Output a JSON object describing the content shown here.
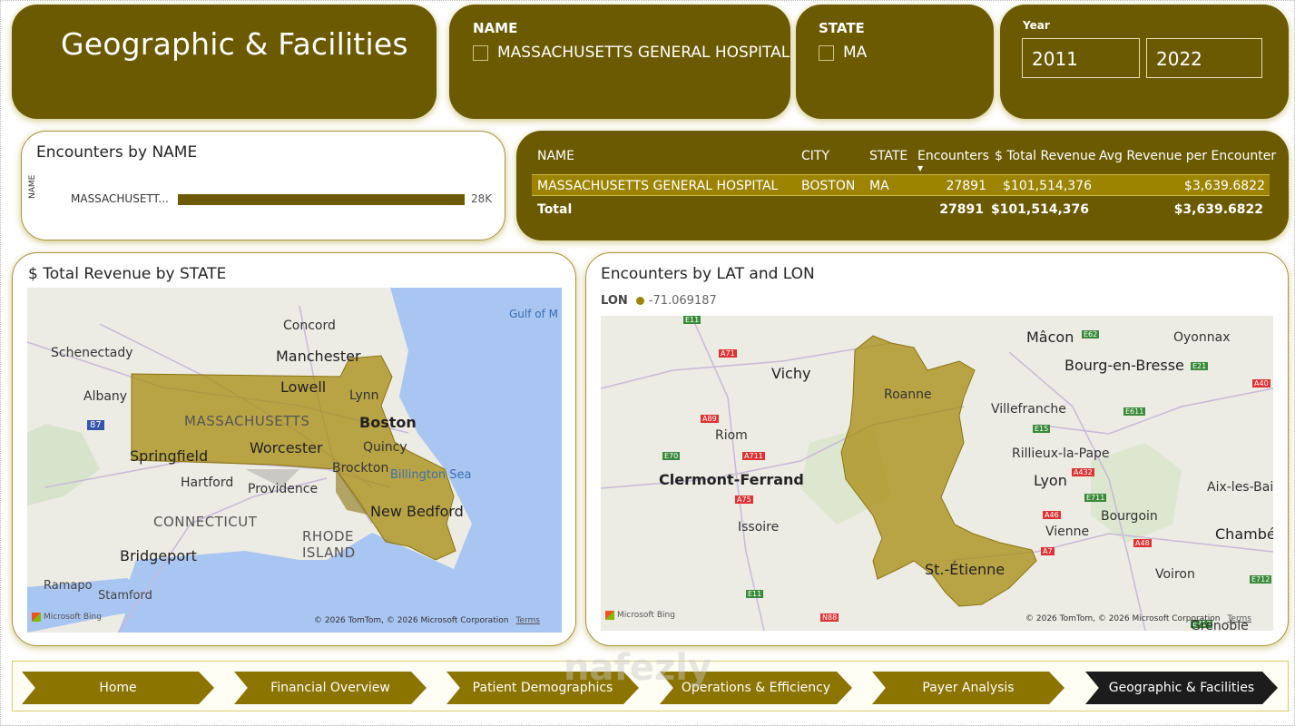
{
  "header": {
    "title": "Geographic & Facilities"
  },
  "slicers": {
    "name": {
      "label": "NAME",
      "item": "MASSACHUSETTS GENERAL HOSPITAL"
    },
    "state": {
      "label": "STATE",
      "item": "MA"
    },
    "year": {
      "label": "Year",
      "start": "2011",
      "end": "2022"
    }
  },
  "encounters_by_name": {
    "title": "Encounters by NAME",
    "axis_label": "NAME",
    "category": "MASSACHUSETT...",
    "value_label": "28K",
    "chart_data": {
      "type": "bar",
      "categories": [
        "MASSACHUSETT..."
      ],
      "values": [
        27891
      ],
      "ylabel": "NAME"
    }
  },
  "table": {
    "columns": [
      "NAME",
      "CITY",
      "STATE",
      "Encounters",
      "$ Total Revenue",
      "Avg Revenue per Encounter"
    ],
    "row": [
      "MASSACHUSETTS GENERAL HOSPITAL",
      "BOSTON",
      "MA",
      "27891",
      "$101,514,376",
      "$3,639.6822"
    ],
    "total": [
      "Total",
      "",
      "",
      "27891",
      "$101,514,376",
      "$3,639.6822"
    ]
  },
  "revenue_map": {
    "title": "$ Total Revenue by STATE",
    "labels": [
      "Concord",
      "Schenectady",
      "Manchester",
      "Albany",
      "Lowell",
      "Lynn",
      "MASSACHUSETTS",
      "Boston",
      "Worcester",
      "Quincy",
      "Springfield",
      "Brockton",
      "Billington Sea",
      "Hartford",
      "Providence",
      "New Bedford",
      "CONNECTICUT",
      "RHODE",
      "ISLAND",
      "Bridgeport",
      "Ramapo",
      "Stamford",
      "Gulf of M",
      "87"
    ],
    "copyright": "© 2026 TomTom, © 2026 Microsoft Corporation",
    "terms": "Terms",
    "bing": "Microsoft Bing"
  },
  "latlon_map": {
    "title": "Encounters by LAT and LON",
    "legend_label": "LON",
    "legend_value": "-71.069187",
    "legend_color": "#9c8400",
    "labels": [
      "Mâcon",
      "Oyonnax",
      "Vichy",
      "Bourg-en-Bresse",
      "Roanne",
      "Villefranche",
      "Riom",
      "Rillieux-la-Pape",
      "Clermont-Ferrand",
      "Lyon",
      "Aix-les-Bai",
      "Bourgoin",
      "Vienne",
      "Issoire",
      "Chambér",
      "St.-Étienne",
      "Voiron",
      "E11",
      "A71",
      "E62",
      "E21",
      "A40",
      "A89",
      "E611",
      "E15",
      "E70",
      "A711",
      "A432",
      "E711",
      "A75",
      "A46",
      "A7",
      "A48",
      "E712",
      "E11",
      "N88",
      "E713",
      "Grenoble"
    ],
    "copyright": "© 2026 TomTom, © 2026 Microsoft Corporation",
    "terms": "Terms",
    "bing": "Microsoft Bing"
  },
  "nav": {
    "items": [
      "Home",
      "Financial Overview",
      "Patient Demographics",
      "Operations & Efficiency",
      "Payer Analysis",
      "Geographic & Facilities"
    ],
    "active": "Geographic & Facilities"
  },
  "watermark": "nafezly",
  "colors": {
    "olive": "#6b5a00",
    "bar": "#6b5a00",
    "highlight": "#9c8400",
    "nav_active": "#1c1c1c",
    "nav": "#8c7400",
    "map_fill": "#a88c10"
  }
}
